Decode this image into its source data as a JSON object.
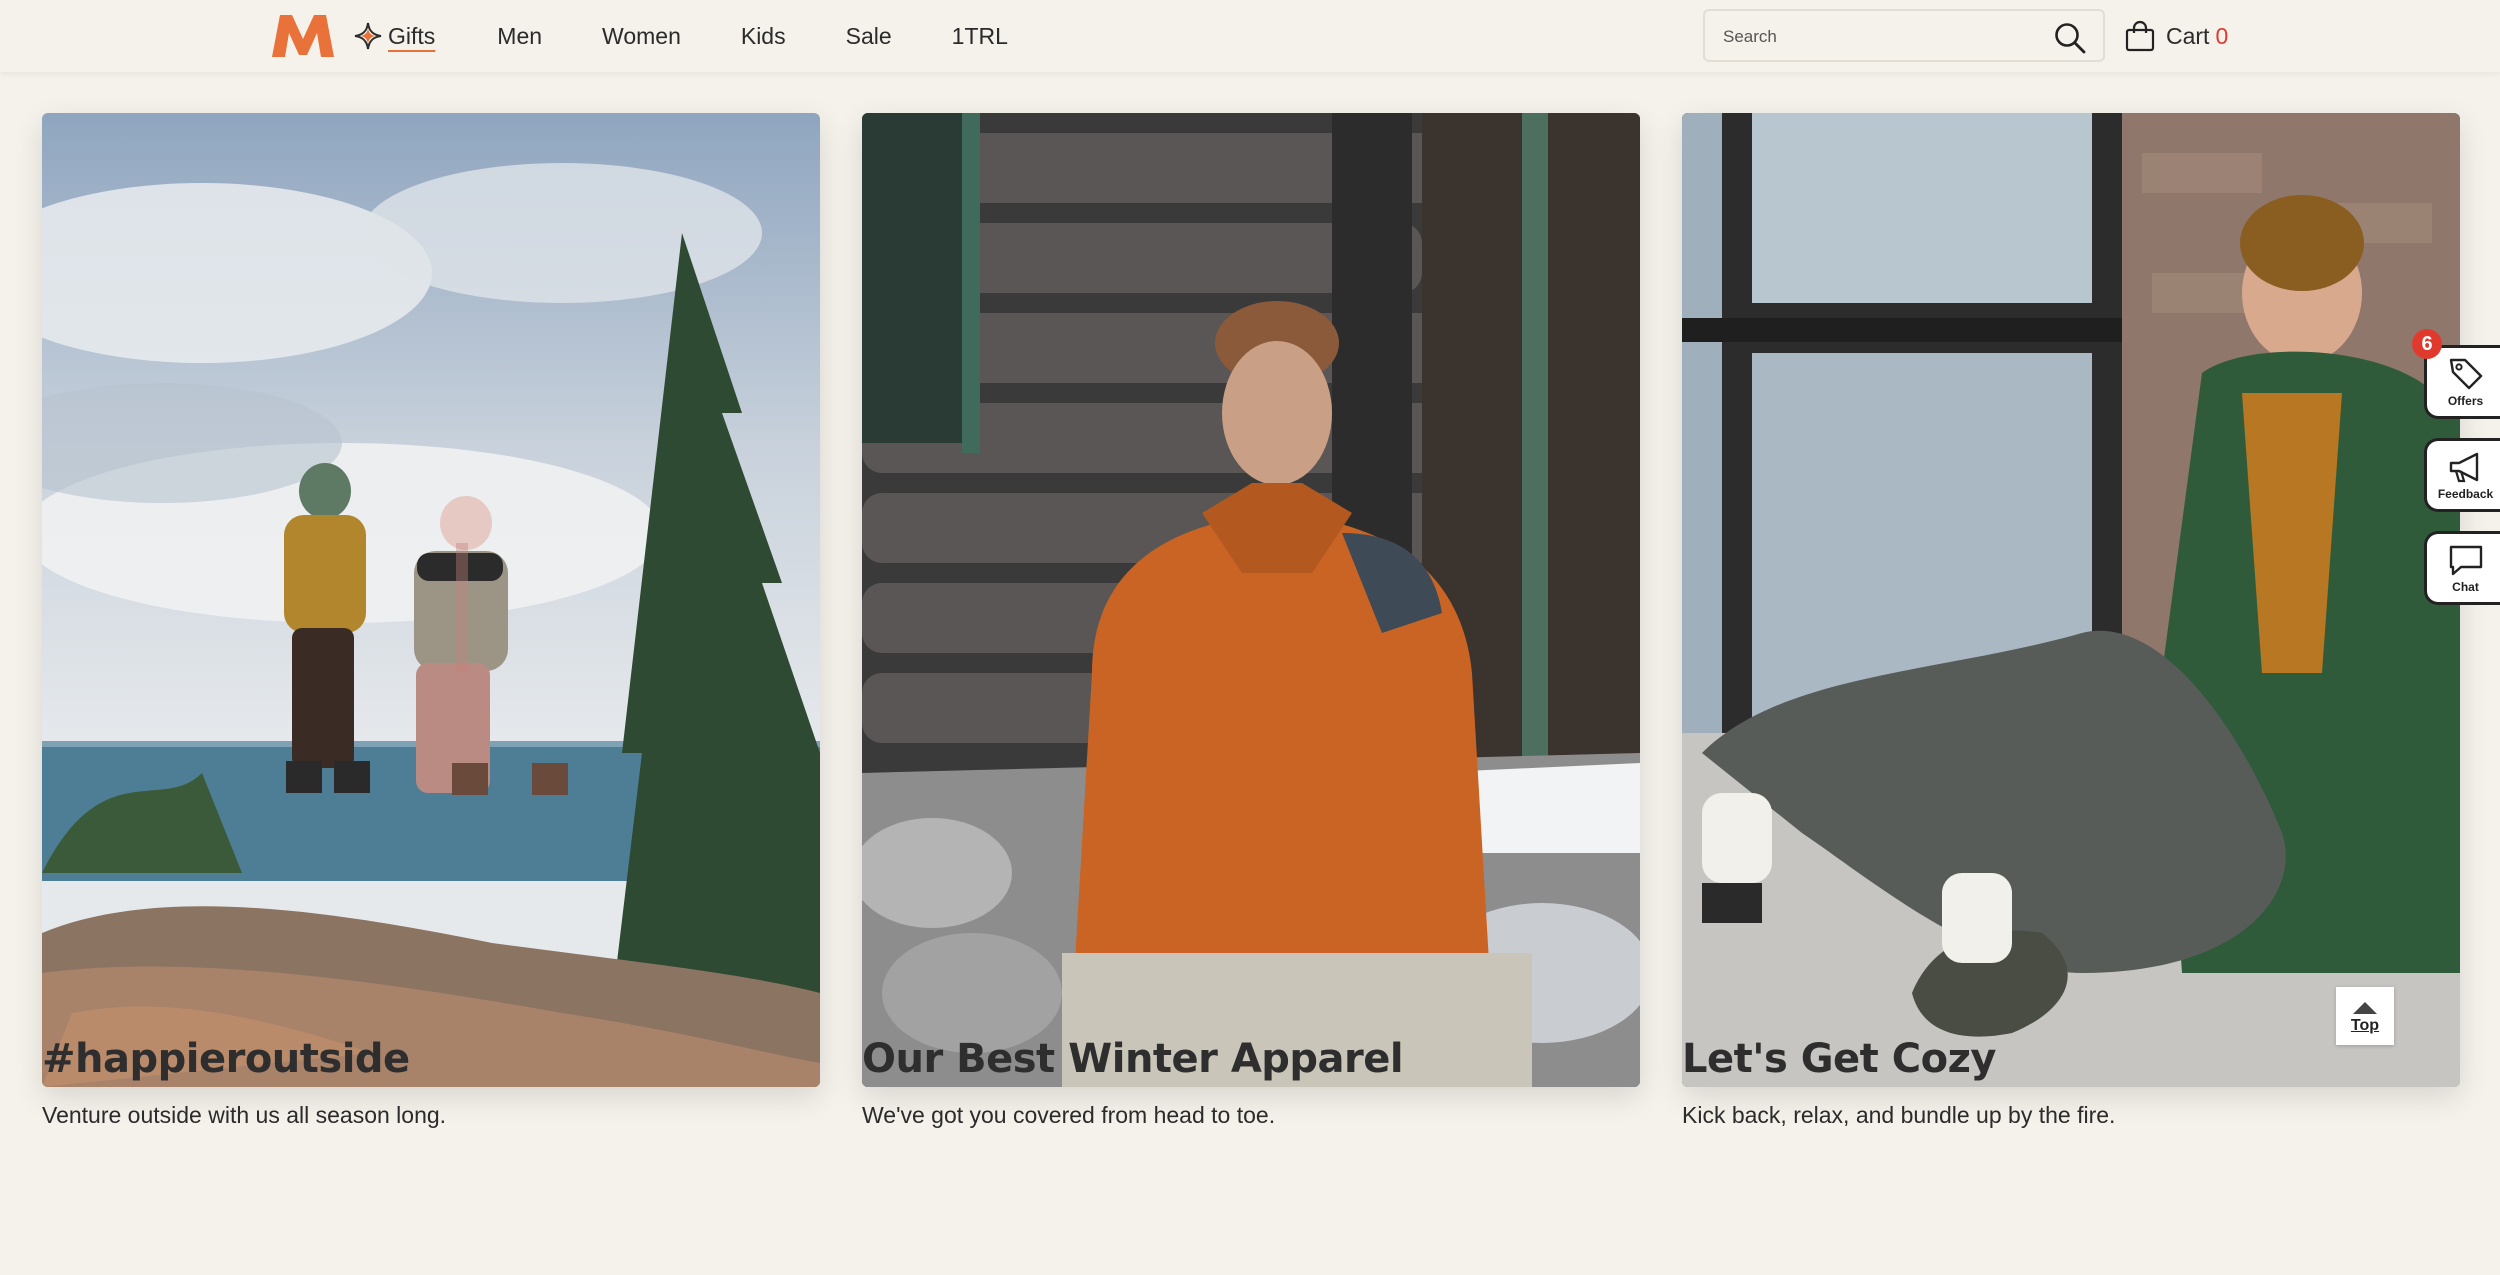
{
  "header": {
    "logo_icon": "merrell-m-logo",
    "nav": {
      "gifts": "Gifts",
      "men": "Men",
      "women": "Women",
      "kids": "Kids",
      "sale": "Sale",
      "trl": "1TRL"
    },
    "search_placeholder": "Search",
    "cart_label": "Cart",
    "cart_count": "0"
  },
  "cards": [
    {
      "title": "#happieroutside",
      "subtitle": "Venture outside with us all season long."
    },
    {
      "title": "Our Best Winter Apparel",
      "subtitle": "We've got you covered from head to toe."
    },
    {
      "title": "Let's Get Cozy",
      "subtitle": "Kick back, relax, and bundle up by the fire."
    }
  ],
  "side_widgets": {
    "offers_label": "Offers",
    "offers_badge": "6",
    "feedback_label": "Feedback",
    "chat_label": "Chat"
  },
  "top_button_label": "Top",
  "colors": {
    "brand_orange": "#e8723a",
    "background": "#f5f1eb",
    "cart_count": "#e03a2f"
  }
}
